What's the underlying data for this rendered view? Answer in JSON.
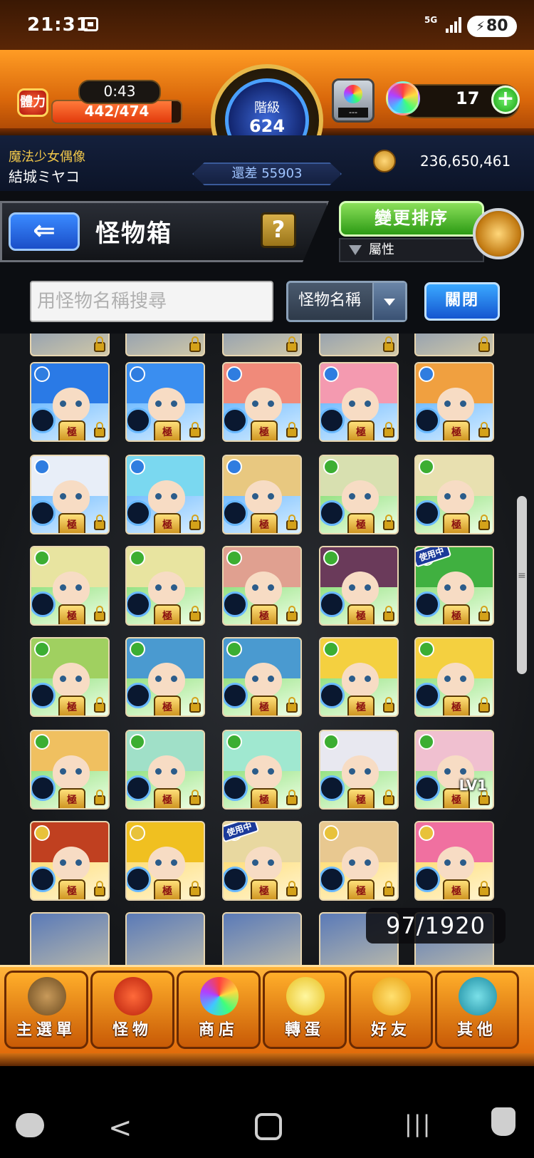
{
  "status_bar": {
    "time": "21:31",
    "network": "5G",
    "battery": "80"
  },
  "header": {
    "stamina_label": "體力",
    "timer": "0:43",
    "stamina": "442/474",
    "stamina_fraction": 0.93,
    "rank_label": "階級",
    "rank": "624",
    "egg_counter": "---",
    "orb_count": "17",
    "plus_label": "+"
  },
  "player": {
    "title": "魔法少女偶像",
    "name": "結城ミヤコ",
    "exp_remaining": "還差 55903",
    "coins": "236,650,461"
  },
  "title_bar": {
    "back_label": "⇐",
    "page_title": "怪物箱",
    "help_label": "?",
    "sort_button": "變更排序",
    "sort_mode": "屬性"
  },
  "search": {
    "placeholder": "用怪物名稱搜尋",
    "filter_selected": "怪物名稱",
    "close_label": "關閉"
  },
  "monsters": {
    "count": "97/1920",
    "badge_text": "極",
    "in_use_text": "使用中",
    "level_text": "LV1"
  },
  "nav": {
    "items": [
      {
        "label": "主選單",
        "icon": "gate-icon"
      },
      {
        "label": "怪物",
        "icon": "dragon-icon"
      },
      {
        "label": "商店",
        "icon": "orb-icon"
      },
      {
        "label": "轉蛋",
        "icon": "egg-icon"
      },
      {
        "label": "好友",
        "icon": "friends-icon"
      },
      {
        "label": "其他",
        "icon": "diamond-icon"
      }
    ]
  },
  "colors": {
    "header_orange": "#e27410",
    "fire": "#e0312a",
    "water": "#2f7de0",
    "wood": "#3cae32",
    "light": "#e8c23a",
    "dark": "#7a3ab8"
  }
}
